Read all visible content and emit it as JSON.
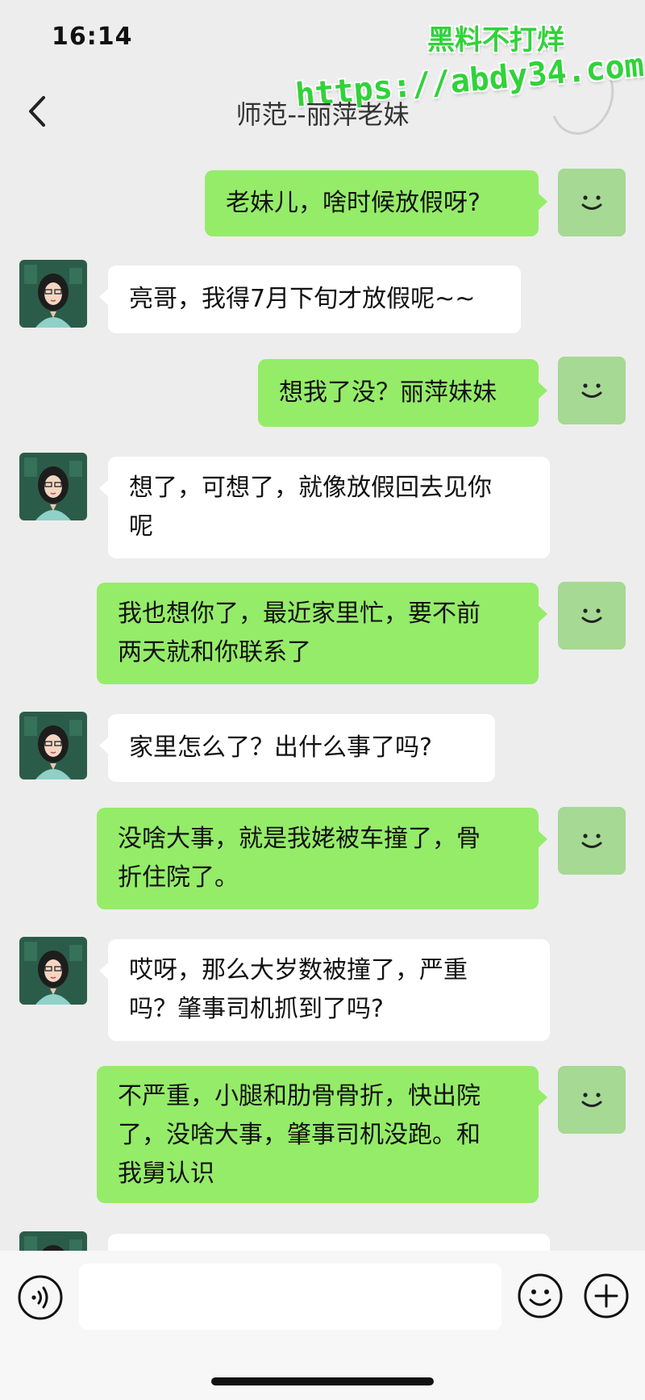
{
  "status_bar": {
    "time": "16:14"
  },
  "watermark": {
    "line1": "黑料不打烊",
    "line2": "https://abdy34.com"
  },
  "header": {
    "title": "师范--丽萍老妹"
  },
  "messages": [
    {
      "sender": "self",
      "lines": [
        "老妹儿，啥时候放假呀?"
      ]
    },
    {
      "sender": "contact",
      "lines": [
        "亮哥，我得7月下旬才放假呢~~"
      ]
    },
    {
      "sender": "self",
      "lines": [
        "想我了没？丽萍妹妹"
      ]
    },
    {
      "sender": "contact",
      "lines": [
        "想了，可想了，就像放假回去见你",
        "呢"
      ]
    },
    {
      "sender": "self",
      "lines": [
        "我也想你了，最近家里忙，要不前",
        "两天就和你联系了"
      ]
    },
    {
      "sender": "contact",
      "lines": [
        "家里怎么了？出什么事了吗?"
      ]
    },
    {
      "sender": "self",
      "lines": [
        "没啥大事，就是我姥被车撞了，骨",
        "折住院了。"
      ]
    },
    {
      "sender": "contact",
      "lines": [
        "哎呀，那么大岁数被撞了，严重",
        "吗？肇事司机抓到了吗?"
      ]
    },
    {
      "sender": "self",
      "lines": [
        "不严重，小腿和肋骨骨折，快出院",
        "了，没啥大事，肇事司机没跑。和",
        "我舅认识"
      ]
    },
    {
      "sender": "contact",
      "lines": [
        ""
      ]
    }
  ],
  "icons": {
    "back": "chevron-left-icon",
    "self_avatar": "smiley-avatar-icon",
    "voice": "voice-icon",
    "emoji": "emoji-icon",
    "plus": "plus-icon"
  },
  "colors": {
    "background": "#ededed",
    "outgoing_bubble": "#95ec69",
    "incoming_bubble": "#ffffff",
    "self_avatar": "#a6d993",
    "watermark": "#31d23a"
  }
}
